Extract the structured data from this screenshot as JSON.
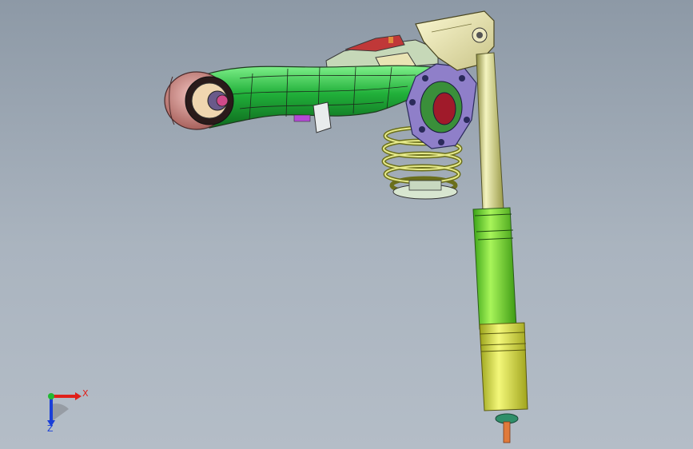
{
  "viewport": {
    "colors": {
      "background_top": "#8d99a6",
      "background_bottom": "#b4bdc7"
    }
  },
  "model": {
    "parts": [
      "lower-control-arm",
      "hub-bushing",
      "knuckle-plate",
      "coil-spring",
      "shock-absorber",
      "upper-mount-bracket",
      "bracket-assembly"
    ],
    "colors": {
      "arm": "#1fae2e",
      "hub": "#d38b86",
      "plate": "#8f7fc9",
      "spring": "#c9cf5a",
      "shock_upper": "#d8d88a",
      "shock_lower": "#7fe12a",
      "shock_bottom": "#e4ea44",
      "bracket": "#f0ecb0"
    }
  },
  "triad": {
    "x_label": "X",
    "z_label": "Z",
    "colors": {
      "x": "#e0201a",
      "y": "#21b832",
      "z": "#1a3fd8"
    }
  }
}
